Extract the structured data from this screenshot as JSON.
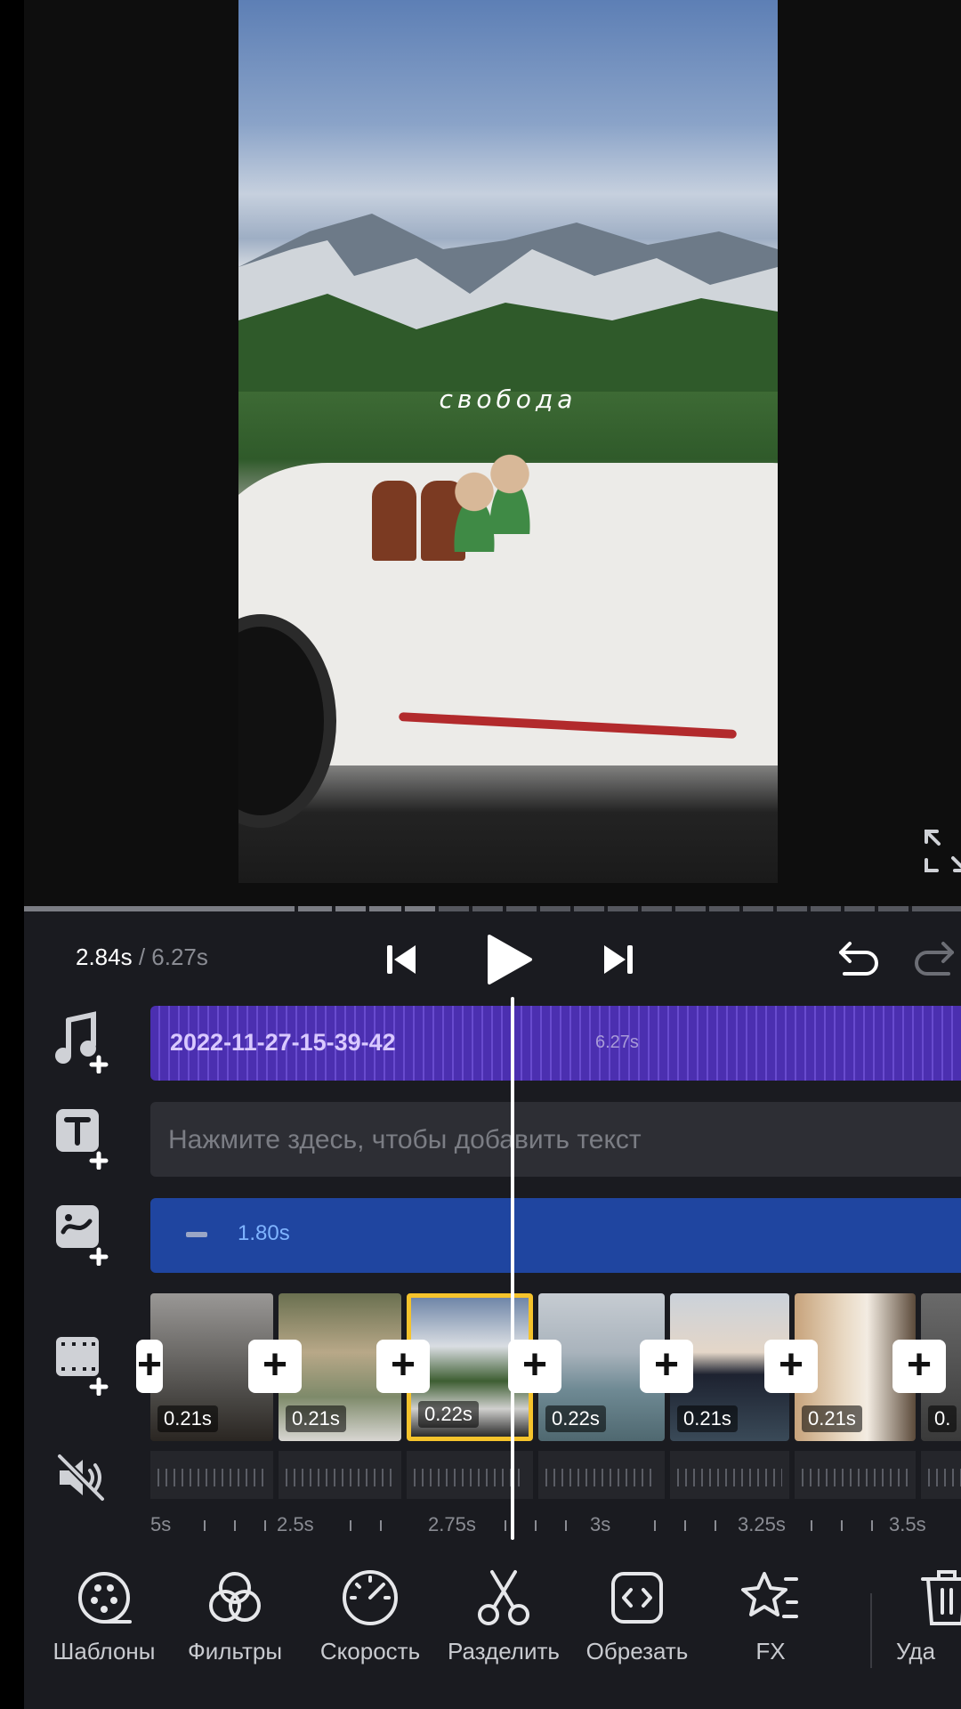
{
  "preview": {
    "overlay_text": "свобода"
  },
  "playback": {
    "current_time": "2.84s",
    "separator": " / ",
    "total_time": "6.27s"
  },
  "tracks": {
    "audio": {
      "title": "2022-11-27-15-39-42",
      "duration": "6.27s"
    },
    "text": {
      "placeholder": "Нажмите здесь, чтобы добавить текст"
    },
    "sticker": {
      "duration": "1.80s"
    }
  },
  "clips": [
    {
      "duration": "0.21s"
    },
    {
      "duration": "0.21s"
    },
    {
      "duration": "0.22s",
      "selected": true
    },
    {
      "duration": "0.22s"
    },
    {
      "duration": "0.21s"
    },
    {
      "duration": "0.21s"
    },
    {
      "duration": "0."
    }
  ],
  "ruler": {
    "labels": [
      "5s",
      "2.5s",
      "2.75s",
      "3s",
      "3.25s",
      "3.5s"
    ]
  },
  "toolbar": {
    "items": [
      {
        "label": "Шаблоны",
        "icon": "templates-icon"
      },
      {
        "label": "Фильтры",
        "icon": "filters-icon"
      },
      {
        "label": "Скорость",
        "icon": "speed-icon"
      },
      {
        "label": "Разделить",
        "icon": "scissors-icon"
      },
      {
        "label": "Обрезать",
        "icon": "trim-icon"
      },
      {
        "label": "FX",
        "icon": "fx-star-icon"
      },
      {
        "label": "Уда",
        "icon": "trash-icon"
      }
    ]
  },
  "colors": {
    "accent_selected": "#f5c32c",
    "audio_track": "#4b2fb0",
    "sticker_track": "#1f45a0",
    "background": "#1a1b20"
  }
}
